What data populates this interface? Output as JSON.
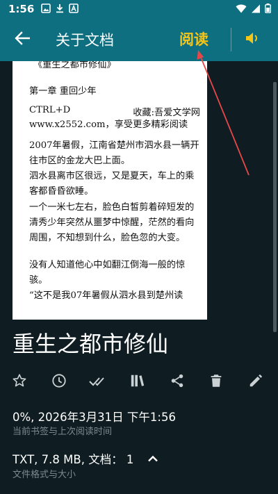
{
  "status_bar": {
    "time": "1:56",
    "icons_left": [
      "image-icon",
      "download-icon",
      "font-icon"
    ],
    "icons_right": [
      "wifi-icon",
      "signal-icon",
      "battery-icon"
    ]
  },
  "app_bar": {
    "title": "关于文档",
    "read_label": "阅读",
    "icons": [
      "back-arrow-icon",
      "speaker-icon"
    ]
  },
  "preview": {
    "title": "《重生之都市修仙》",
    "chapter": "第一章 重回少年",
    "ctrl_left": "CTRL+D",
    "ctrl_right": "收藏:吾爱文学网",
    "site_line": "www.x2552.com，享受更多精彩阅读",
    "paragraphs": [
      "2007年暑假，江南省楚州市泗水县一辆开往市区的金龙大巴上面。",
      "泗水县离市区很远，又是夏天，车上的乘客都昏昏欲睡。",
      "一个一米七左右，脸色白皙剪着碎短发的清秀少年突然从噩梦中惊醒，茫然的看向周围，不知想到什么，脸色忽的大变。",
      "没有人知道他心中如翻江倒海一般的惊骇。",
      "“这不是我07年暑假从泗水县到楚州读"
    ]
  },
  "book": {
    "title": "重生之都市修仙"
  },
  "actions": [
    {
      "name": "star-icon"
    },
    {
      "name": "clock-icon"
    },
    {
      "name": "double-check-icon"
    },
    {
      "name": "bookshelf-icon"
    },
    {
      "name": "share-icon"
    },
    {
      "name": "delete-icon"
    },
    {
      "name": "edit-icon"
    }
  ],
  "info": {
    "progress_line": "0%, 2026年3月31日 下午1:56",
    "progress_caption": "当前书签与上次阅读时间",
    "format_line": "TXT, 7.8 MB, 文档：  1",
    "format_caption": "文件格式与大小"
  },
  "colors": {
    "app_bar": "#0d6f80",
    "background": "#0f1d22",
    "read_accent": "#f5c518",
    "annotation_arrow": "#e8474a",
    "caption": "#7d8a8f"
  }
}
